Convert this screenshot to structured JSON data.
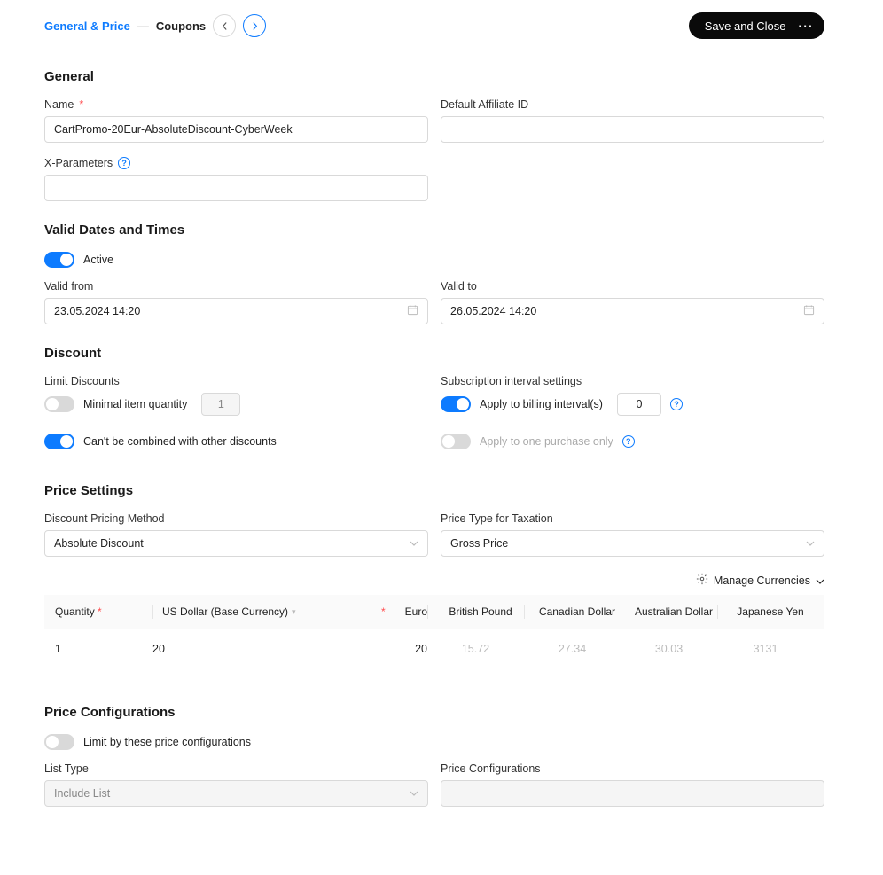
{
  "breadcrumbs": {
    "step1": "General & Price",
    "step2": "Coupons"
  },
  "actions": {
    "save_close": "Save and Close"
  },
  "general": {
    "title": "General",
    "name_label": "Name",
    "name_value": "CartPromo-20Eur-AbsoluteDiscount-CyberWeek",
    "affiliate_label": "Default Affiliate ID",
    "affiliate_value": "",
    "xparams_label": "X-Parameters",
    "xparams_value": ""
  },
  "valid": {
    "title": "Valid Dates and Times",
    "active_label": "Active",
    "from_label": "Valid from",
    "from_value": "23.05.2024 14:20",
    "to_label": "Valid to",
    "to_value": "26.05.2024 14:20"
  },
  "discount": {
    "title": "Discount",
    "limit_label": "Limit Discounts",
    "min_qty_label": "Minimal item quantity",
    "min_qty_value": "1",
    "cant_combine_label": "Can't be combined with other discounts",
    "sub_settings_label": "Subscription interval settings",
    "apply_billing_label": "Apply to billing interval(s)",
    "apply_billing_value": "0",
    "apply_one_label": "Apply to one purchase only"
  },
  "price_settings": {
    "title": "Price Settings",
    "method_label": "Discount Pricing Method",
    "method_value": "Absolute Discount",
    "taxtype_label": "Price Type for Taxation",
    "taxtype_value": "Gross Price"
  },
  "currencies": {
    "manage_label": "Manage Currencies",
    "headers": {
      "quantity": "Quantity",
      "usd": "US Dollar (Base Currency)",
      "eur": "Euro",
      "gbp": "British Pound",
      "cad": "Canadian Dollar",
      "aud": "Australian Dollar",
      "jpy": "Japanese Yen"
    },
    "row": {
      "quantity": "1",
      "usd": "20",
      "eur": "20",
      "gbp": "15.72",
      "cad": "27.34",
      "aud": "30.03",
      "jpy": "3131"
    }
  },
  "price_config": {
    "title": "Price Configurations",
    "limit_label": "Limit by these price configurations",
    "list_type_label": "List Type",
    "list_type_value": "Include List",
    "pc_label": "Price Configurations",
    "pc_value": ""
  }
}
